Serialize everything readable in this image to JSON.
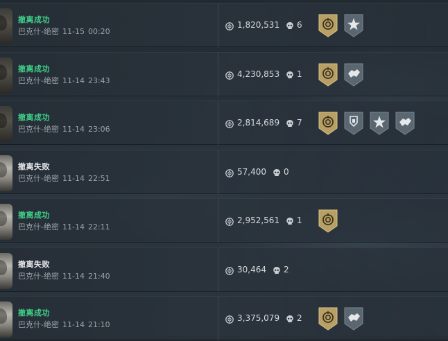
{
  "records": [
    {
      "status": "撤离成功",
      "result": "success",
      "map": "巴克什-绝密",
      "date": "11-15",
      "time": "00:20",
      "value": "1,820,531",
      "kills": "6",
      "avatar": "dark",
      "badges": [
        "gold-target-badge",
        "silver-star-badge"
      ]
    },
    {
      "status": "撤离成功",
      "result": "success",
      "map": "巴克什-绝密",
      "date": "11-14",
      "time": "23:43",
      "value": "4,230,853",
      "kills": "1",
      "avatar": "dark",
      "badges": [
        "gold-target-badge",
        "silver-handshake-badge"
      ]
    },
    {
      "status": "撤离成功",
      "result": "success",
      "map": "巴克什-绝密",
      "date": "11-14",
      "time": "23:06",
      "value": "2,814,689",
      "kills": "7",
      "avatar": "dark",
      "badges": [
        "gold-target-badge",
        "silver-shield-badge",
        "silver-star-badge",
        "silver-handshake-badge"
      ]
    },
    {
      "status": "撤离失败",
      "result": "fail",
      "map": "巴克什-绝密",
      "date": "11-14",
      "time": "22:51",
      "value": "57,400",
      "kills": "0",
      "avatar": "light",
      "badges": []
    },
    {
      "status": "撤离成功",
      "result": "success",
      "map": "巴克什-绝密",
      "date": "11-14",
      "time": "22:11",
      "value": "2,952,561",
      "kills": "1",
      "avatar": "light",
      "badges": [
        "gold-target-badge"
      ]
    },
    {
      "status": "撤离失败",
      "result": "fail",
      "map": "巴克什-绝密",
      "date": "11-14",
      "time": "21:40",
      "value": "30,464",
      "kills": "2",
      "avatar": "light",
      "badges": []
    },
    {
      "status": "撤离成功",
      "result": "success",
      "map": "巴克什-绝密",
      "date": "11-14",
      "time": "21:10",
      "value": "3,375,079",
      "kills": "2",
      "avatar": "light",
      "badges": [
        "gold-target-badge",
        "silver-handshake-badge"
      ]
    }
  ],
  "colors": {
    "success": "#3fd08a",
    "fail": "#e6e8ea",
    "gold_badge": "#b8a064",
    "silver_badge": "#5a6670"
  }
}
